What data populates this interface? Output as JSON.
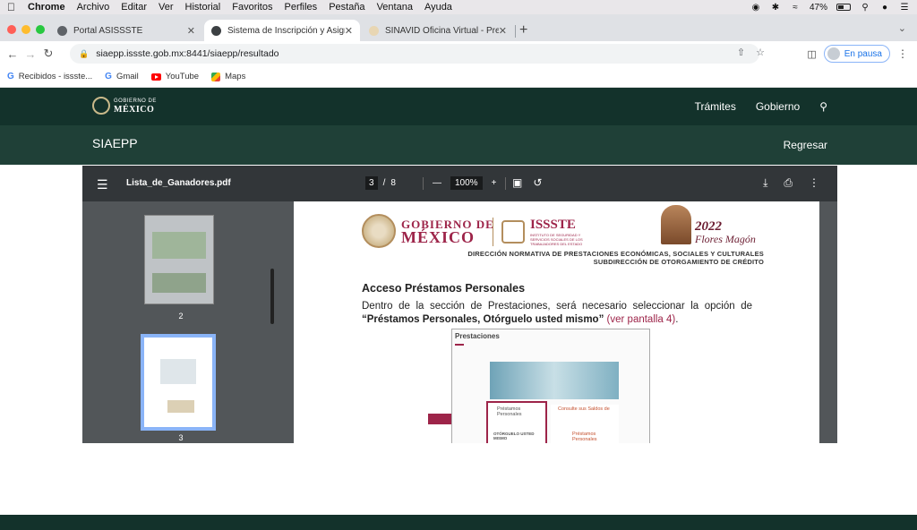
{
  "menubar": {
    "app": "Chrome",
    "items": [
      "Archivo",
      "Editar",
      "Ver",
      "Historial",
      "Favoritos",
      "Perfiles",
      "Pestaña",
      "Ventana",
      "Ayuda"
    ],
    "battery": "47%"
  },
  "tabs": [
    {
      "title": "Portal ASISSSTE",
      "active": false
    },
    {
      "title": "Sistema de Inscripción y Asign",
      "active": true
    },
    {
      "title": "SINAVID Oficina Virtual - Prest",
      "active": false
    }
  ],
  "address": {
    "url": "siaepp.issste.gob.mx:8441/siaepp/resultado",
    "profile_label": "En pausa"
  },
  "bookmarks": [
    "Recibidos - issste...",
    "Gmail",
    "YouTube",
    "Maps"
  ],
  "gov_header": {
    "logo_small": "GOBIERNO DE",
    "logo_big": "MÉXICO",
    "nav": [
      "Trámites",
      "Gobierno"
    ]
  },
  "subheader": {
    "site": "SIAEPP",
    "back": "Regresar"
  },
  "pdf": {
    "filename": "Lista_de_Ganadores.pdf",
    "current_page": "3",
    "total_pages": "8",
    "zoom": "100%",
    "thumbnails": [
      "2",
      "3"
    ]
  },
  "document": {
    "gob_line1": "GOBIERNO DE",
    "gob_line2": "MÉXICO",
    "issste": "ISSSTE",
    "issste_sub": "INSTITUTO DE SEGURIDAD Y SERVICIOS SOCIALES DE LOS TRABAJADORES DEL ESTADO",
    "year": "2022",
    "year_name": "Flores Magón",
    "direction": "DIRECCIÓN NORMATIVA DE PRESTACIONES ECONÓMICAS, SOCIALES Y CULTURALES",
    "subdirection": "SUBDIRECCIÓN DE OTORGAMIENTO DE CRÉDITO",
    "section_title": "Acceso Préstamos Personales",
    "para_start": "Dentro de la sección de Prestaciones, será necesario seleccionar la opción de",
    "para_bold": "“Préstamos Personales, Otórguelo usted mismo”",
    "para_link": "(ver pantalla 4)",
    "para_end": ".",
    "screenshot_title": "Prestaciones",
    "card1_title": "Préstamos Personales",
    "card1_sub": "OTÓRGUELO USTED MISMO",
    "card2_title": "Consulte sus Saldos de",
    "card2_sub": "Préstamos Personales"
  }
}
